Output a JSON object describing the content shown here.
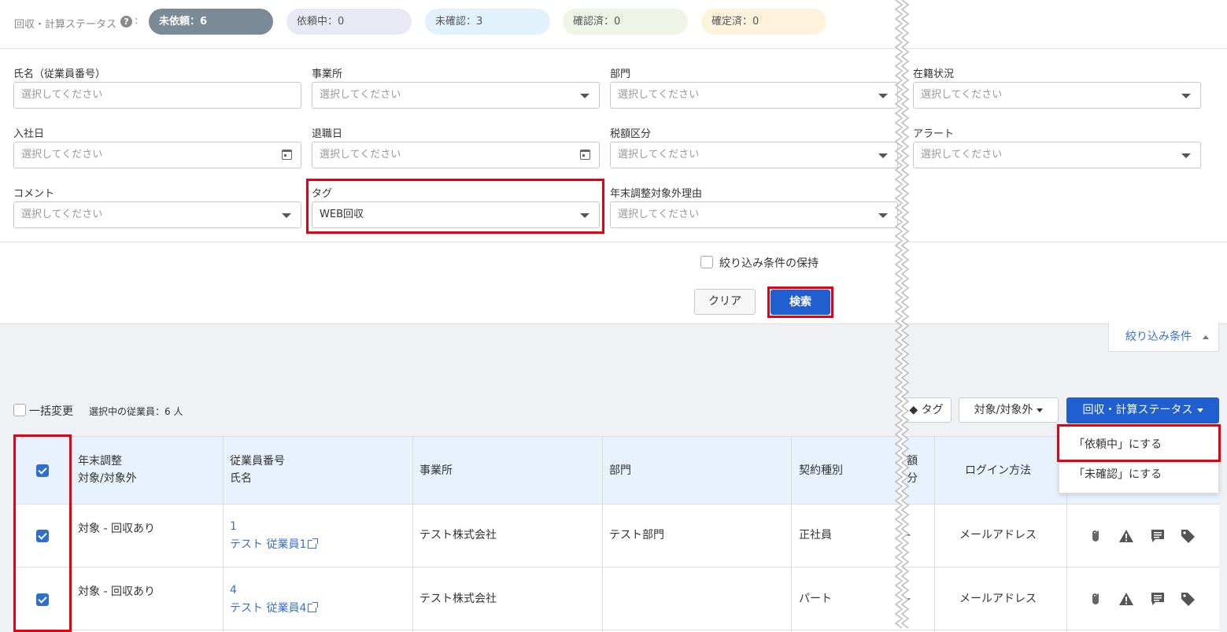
{
  "status_bar": {
    "label": "回収・計算ステータス",
    "help": "?",
    "colon": ":",
    "pills": [
      {
        "label": "未依頼：6"
      },
      {
        "label": "依頼中：0"
      },
      {
        "label": "未確認：3"
      },
      {
        "label": "確認済：0"
      },
      {
        "label": "確定済：0"
      }
    ]
  },
  "filters": {
    "placeholder": "選択してください",
    "name": {
      "label": "氏名（従業員番号）"
    },
    "office": {
      "label": "事業所"
    },
    "department": {
      "label": "部門"
    },
    "employment": {
      "label": "在籍状況"
    },
    "join_date": {
      "label": "入社日"
    },
    "leave_date": {
      "label": "退職日"
    },
    "tax_class": {
      "label": "税額区分"
    },
    "alert": {
      "label": "アラート"
    },
    "comment": {
      "label": "コメント"
    },
    "tag": {
      "label": "タグ",
      "value": "WEB回収"
    },
    "exclusion_reason": {
      "label": "年末調整対象外理由"
    },
    "keep_conditions": "絞り込み条件の保持",
    "clear_button": "クリア",
    "search_button": "検索"
  },
  "filter_toggle": "絞り込み条件",
  "bulk": {
    "label": "一括変更",
    "selected_count": "選択中の従業員：6 人"
  },
  "toolbar": {
    "tag": "タグ",
    "target": "対象/対象外",
    "status": "回収・計算ステータス"
  },
  "menu": {
    "items": [
      "「依頼中」にする",
      "「未確認」にする"
    ]
  },
  "table": {
    "headers": {
      "adjustment": [
        "年末調整",
        "対象/対象外"
      ],
      "employee": [
        "従業員番号",
        "氏名"
      ],
      "office": "事業所",
      "department": "部門",
      "contract": "契約種別",
      "tax_partial": [
        "額",
        "分"
      ],
      "login": "ログイン方法"
    },
    "rows": [
      {
        "adjustment": "対象 - 回収あり",
        "number": "1",
        "name": "テスト 従業員1",
        "office": "テスト株式会社",
        "department": "テスト部門",
        "contract": "正社員",
        "tax_partial": "-",
        "login": "メールアドレス"
      },
      {
        "adjustment": "対象 - 回収あり",
        "number": "4",
        "name": "テスト 従業員4",
        "office": "テスト株式会社",
        "department": "",
        "contract": "パート",
        "tax_partial": "-",
        "login": "メールアドレス"
      }
    ]
  }
}
